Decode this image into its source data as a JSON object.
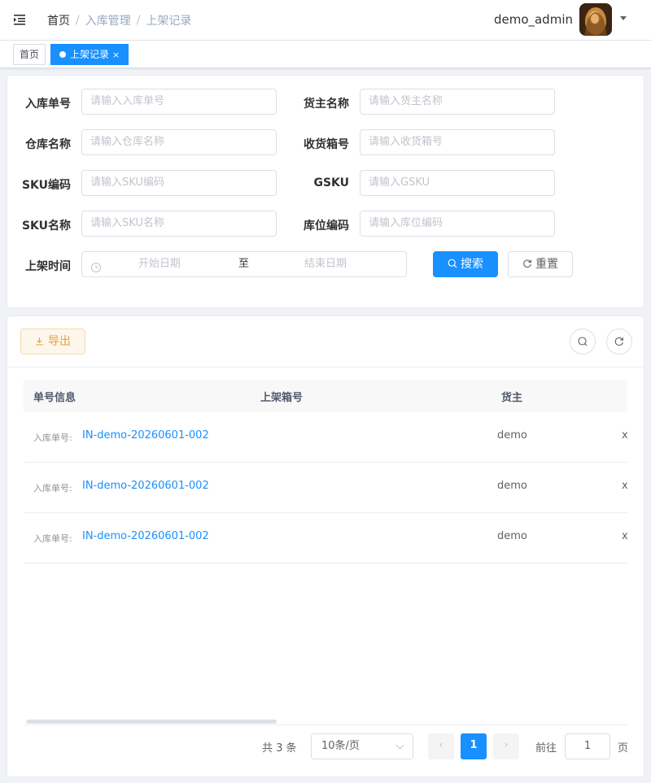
{
  "navbar": {
    "breadcrumb": [
      "首页",
      "入库管理",
      "上架记录"
    ],
    "separator": "/",
    "username": "demo_admin",
    "icons": [
      "hamburger-icon",
      "caret-down-icon"
    ]
  },
  "tags": {
    "home": "首页",
    "active": "上架记录",
    "close": "×"
  },
  "search": {
    "fields": [
      {
        "label": "入库单号",
        "placeholder": "请输入入库单号"
      },
      {
        "label": "货主名称",
        "placeholder": "请输入货主名称"
      },
      {
        "label": "仓库名称",
        "placeholder": "请输入仓库名称"
      },
      {
        "label": "收货箱号",
        "placeholder": "请输入收货箱号"
      },
      {
        "label": "SKU编码",
        "placeholder": "请输入SKU编码"
      },
      {
        "label": "GSKU",
        "placeholder": "请输入GSKU"
      },
      {
        "label": "SKU名称",
        "placeholder": "请输入SKU名称"
      },
      {
        "label": "库位编码",
        "placeholder": "请输入库位编码"
      }
    ],
    "date": {
      "label": "上架时间",
      "start": "开始日期",
      "sep": "至",
      "end": "结束日期"
    },
    "search_button": "搜索",
    "reset_button": "重置"
  },
  "toolbar": {
    "export_button": "导出",
    "icons": [
      "search-toggle-icon",
      "refresh-icon"
    ]
  },
  "table": {
    "columns": [
      "单号信息",
      "上架箱号",
      "货主"
    ],
    "rows": [
      {
        "label": "入库单号:",
        "order_no": "IN-demo-20260601-002",
        "owner": "demo",
        "extra": "x"
      },
      {
        "label": "入库单号:",
        "order_no": "IN-demo-20260601-002",
        "owner": "demo",
        "extra": "x"
      },
      {
        "label": "入库单号:",
        "order_no": "IN-demo-20260601-002",
        "owner": "demo",
        "extra": "x"
      }
    ]
  },
  "pagination": {
    "total_text": "共 3 条",
    "page_size": "10条/页",
    "prev": "‹",
    "current_page": "1",
    "next": "›",
    "goto_label": "前往",
    "goto_value": "1",
    "page_unit": "页"
  },
  "colors": {
    "primary": "#1890ff",
    "warning": "#e6a23c"
  }
}
